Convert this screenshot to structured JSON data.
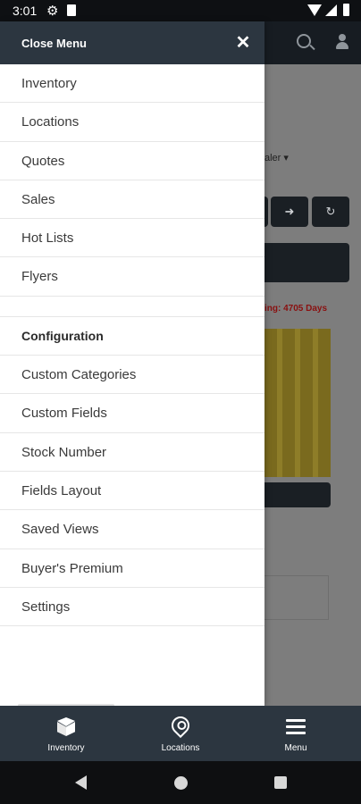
{
  "status_bar": {
    "time": "3:01"
  },
  "background": {
    "dealer_fragment": "aler ▾",
    "red_text_fragment": "ing: 4705 Days"
  },
  "drawer": {
    "close_label": "Close Menu",
    "close_glyph": "✕",
    "items_top": [
      "Inventory",
      "Locations",
      "Quotes",
      "Sales",
      "Hot Lists",
      "Flyers"
    ],
    "section_title": "Configuration",
    "items_config": [
      "Custom Categories",
      "Custom Fields",
      "Stock Number",
      "Fields Layout",
      "Saved Views",
      "Buyer's Premium",
      "Settings"
    ]
  },
  "bottom_nav": {
    "items": [
      {
        "label": "Inventory",
        "icon": "box-icon"
      },
      {
        "label": "Locations",
        "icon": "map-pin-icon"
      },
      {
        "label": "Menu",
        "icon": "hamburger-icon"
      }
    ]
  }
}
